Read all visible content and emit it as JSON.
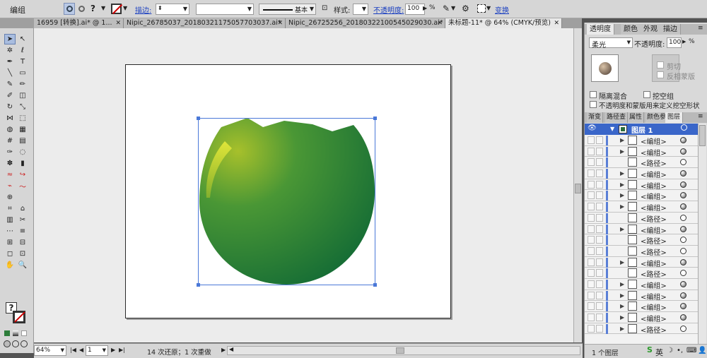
{
  "control_bar": {
    "selection_label": "编组",
    "stroke_label": "描边:",
    "stroke_profile": "基本",
    "style_label": "样式:",
    "opacity_label": "不透明度:",
    "opacity_value": "100",
    "opacity_unit": "%",
    "transform_label": "变换"
  },
  "doc_tabs": [
    {
      "label": "16959 [转换].ai* @ 1..."
    },
    {
      "label": "Nipic_26785037_20180321175057703037.ai*"
    },
    {
      "label": "Nipic_26725256_20180322100545029030.ai*"
    },
    {
      "label": "未标题-11* @ 64% (CMYK/预览)"
    }
  ],
  "tool_question": "?",
  "status_bar": {
    "zoom": "64%",
    "artboard": "1",
    "history": "14 次还原；1 次重做"
  },
  "transparency_panel": {
    "tabs": [
      "透明度",
      "颜色",
      "外观",
      "描边"
    ],
    "blend_mode": "柔光",
    "opacity_label": "不透明度:",
    "opacity_value": "100",
    "opacity_unit": "%",
    "clip_label": "剪切",
    "invert_mask_label": "反相蒙版",
    "isolate_blend_label": "隔离混合",
    "knockout_group_label": "挖空组",
    "opacity_mask_label": "不透明度和蒙版用来定义挖空形状"
  },
  "layers_panel": {
    "tabs": [
      "渐变",
      "路径查",
      "属性",
      "颜色参",
      "图层"
    ],
    "layer_name": "图层 1",
    "rows": [
      {
        "name": "<编组>",
        "expander": true,
        "filled": true
      },
      {
        "name": "<编组>",
        "expander": true,
        "filled": true
      },
      {
        "name": "<路径>",
        "expander": false,
        "filled": false
      },
      {
        "name": "<编组>",
        "expander": true,
        "filled": true
      },
      {
        "name": "<编组>",
        "expander": true,
        "filled": true
      },
      {
        "name": "<编组>",
        "expander": true,
        "filled": true
      },
      {
        "name": "<编组>",
        "expander": true,
        "filled": true
      },
      {
        "name": "<路径>",
        "expander": false,
        "filled": false
      },
      {
        "name": "<编组>",
        "expander": true,
        "filled": true
      },
      {
        "name": "<路径>",
        "expander": false,
        "filled": false
      },
      {
        "name": "<路径>",
        "expander": false,
        "filled": false
      },
      {
        "name": "<编组>",
        "expander": true,
        "filled": true
      },
      {
        "name": "<路径>",
        "expander": false,
        "filled": false
      },
      {
        "name": "<编组>",
        "expander": true,
        "filled": true
      },
      {
        "name": "<编组>",
        "expander": true,
        "filled": true
      },
      {
        "name": "<编组>",
        "expander": true,
        "filled": true
      },
      {
        "name": "<编组>",
        "expander": true,
        "filled": true
      },
      {
        "name": "<路径>",
        "expander": true,
        "filled": false
      }
    ],
    "footer": "1 个图层"
  },
  "ime": {
    "lang": "英"
  },
  "colors": {
    "fruit_light": "#a7c02b",
    "fruit_dark": "#126a35",
    "selection": "#4a78d8"
  }
}
